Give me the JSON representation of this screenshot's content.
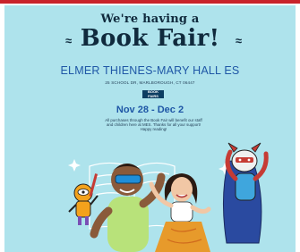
{
  "header": {
    "line1": "We're having a",
    "line2": "Book Fair!",
    "decor_left": "⪤",
    "decor_right": "⪥"
  },
  "school": {
    "name": "ELMER THIENES-MARY HALL ES",
    "address": "25 SCHOOL DR, MARLBOROUGH, CT 06447"
  },
  "logo": {
    "line1": "BOOK",
    "line2": "FAIRS"
  },
  "fair": {
    "dates": "Nov 28 - Dec 2",
    "description": "All purchases through the Book Fair will benefit our staff and children here at MES. Thanks for all your support! Happy reading!"
  },
  "colors": {
    "background": "#aee3ec",
    "headline": "#102a3d",
    "accent_blue": "#1f57a6",
    "top_line": "#c9232b"
  },
  "illustration": {
    "characters": [
      "boy-with-goggles",
      "girl-dancing",
      "superhero-dog",
      "orange-robot"
    ]
  }
}
